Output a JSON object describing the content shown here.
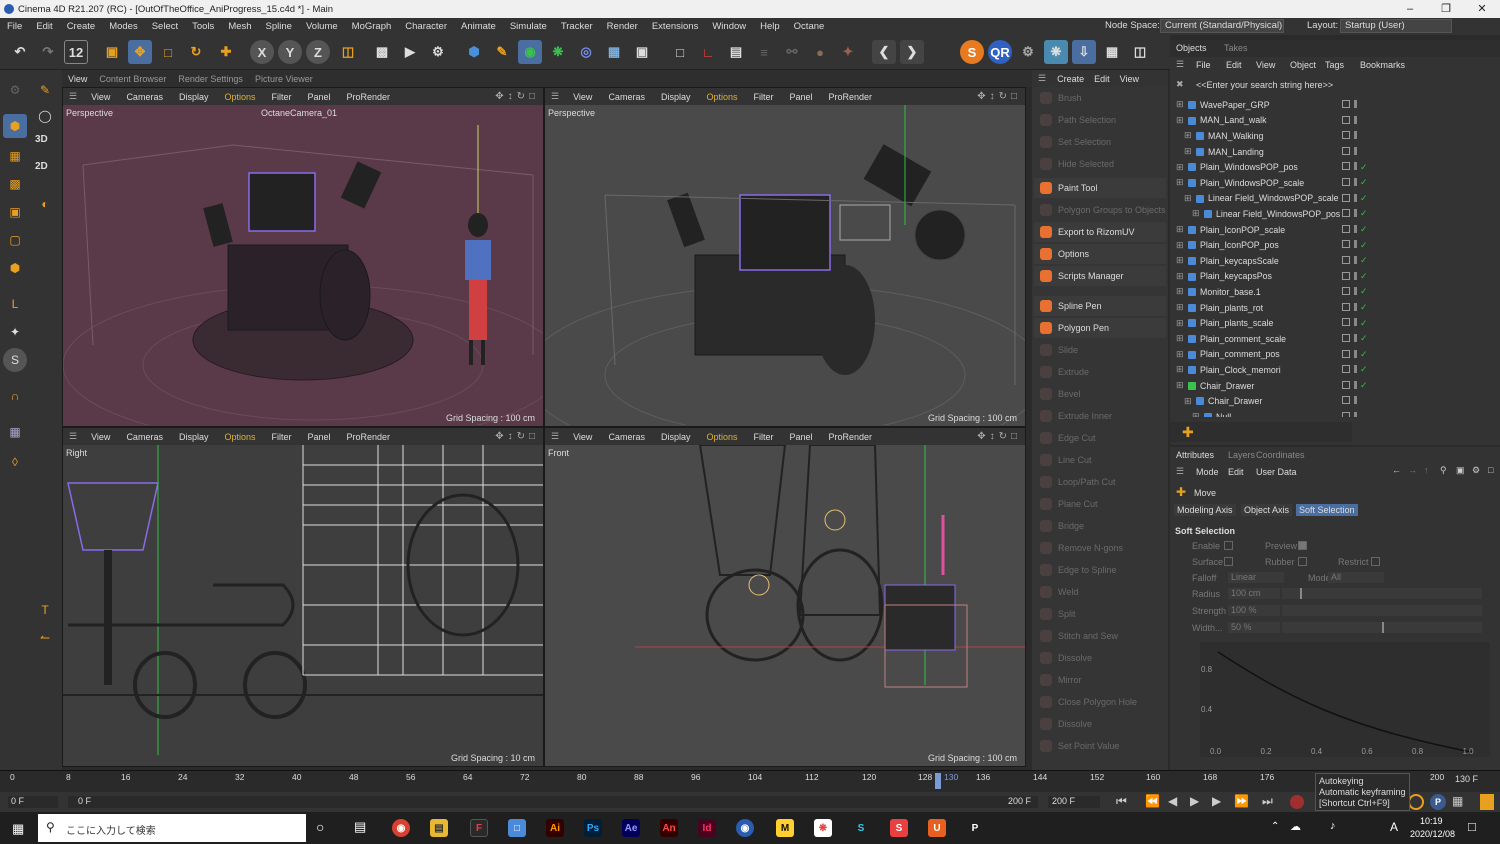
{
  "window": {
    "title": "Cinema 4D R21.207 (RC) - [OutOfTheOffice_AniProgress_15.c4d *] - Main"
  },
  "menu": [
    "File",
    "Edit",
    "Create",
    "Modes",
    "Select",
    "Tools",
    "Mesh",
    "Spline",
    "Volume",
    "MoGraph",
    "Character",
    "Animate",
    "Simulate",
    "Tracker",
    "Render",
    "Extensions",
    "Window",
    "Help",
    "Octane"
  ],
  "nodespace": {
    "label": "Node Space:",
    "value": "Current (Standard/Physical)"
  },
  "layout": {
    "label": "Layout:",
    "value": "Startup (User)"
  },
  "render_tabs": [
    "View",
    "Content Browser",
    "Render Settings",
    "Picture Viewer"
  ],
  "viewport_menu": [
    "View",
    "Cameras",
    "Display",
    "Options",
    "Filter",
    "Panel",
    "ProRender"
  ],
  "viewports": [
    {
      "label": "Perspective",
      "camera": "OctaneCamera_01",
      "grid": "Grid Spacing : 100 cm"
    },
    {
      "label": "Perspective",
      "camera": "",
      "grid": "Grid Spacing : 100 cm"
    },
    {
      "label": "Right",
      "camera": "",
      "grid": "Grid Spacing : 10 cm"
    },
    {
      "label": "Front",
      "camera": "",
      "grid": "Grid Spacing : 100 cm"
    }
  ],
  "left_tool_labels": {
    "threed": "3D",
    "twod": "2D"
  },
  "cmd_menu": [
    "Create",
    "Edit",
    "View"
  ],
  "commands": [
    {
      "label": "Brush",
      "on": false
    },
    {
      "label": "Path Selection",
      "on": false
    },
    {
      "label": "Set Selection",
      "on": false
    },
    {
      "label": "Hide Selected",
      "on": false
    },
    {
      "label": "Paint Tool",
      "on": true
    },
    {
      "label": "Polygon Groups to Objects",
      "on": false
    },
    {
      "label": "Export to RizomUV",
      "on": true
    },
    {
      "label": "Options",
      "on": true
    },
    {
      "label": "Scripts Manager",
      "on": true
    },
    {
      "label": "Spline Pen",
      "on": true
    },
    {
      "label": "Polygon Pen",
      "on": true
    },
    {
      "label": "Slide",
      "on": false
    },
    {
      "label": "Extrude",
      "on": false
    },
    {
      "label": "Bevel",
      "on": false
    },
    {
      "label": "Extrude Inner",
      "on": false
    },
    {
      "label": "Edge Cut",
      "on": false
    },
    {
      "label": "Line Cut",
      "on": false
    },
    {
      "label": "Loop/Path Cut",
      "on": false
    },
    {
      "label": "Plane Cut",
      "on": false
    },
    {
      "label": "Bridge",
      "on": false
    },
    {
      "label": "Remove N-gons",
      "on": false
    },
    {
      "label": "Edge to Spline",
      "on": false
    },
    {
      "label": "Weld",
      "on": false
    },
    {
      "label": "Split",
      "on": false
    },
    {
      "label": "Stitch and Sew",
      "on": false
    },
    {
      "label": "Dissolve",
      "on": false
    },
    {
      "label": "Mirror",
      "on": false
    },
    {
      "label": "Close Polygon Hole",
      "on": false
    },
    {
      "label": "Dissolve",
      "on": false
    },
    {
      "label": "Set Point Value",
      "on": false
    }
  ],
  "objects_tabs": [
    "Objects",
    "Takes"
  ],
  "objects_menu": [
    "File",
    "Edit",
    "View",
    "Object",
    "Tags",
    "Bookmarks"
  ],
  "search_placeholder": "<<Enter your search string here>>",
  "objects": [
    {
      "name": "WavePaper_GRP",
      "indent": 0,
      "check": false
    },
    {
      "name": "MAN_Land_walk",
      "indent": 0,
      "check": false
    },
    {
      "name": "MAN_Walking",
      "indent": 1,
      "check": false
    },
    {
      "name": "MAN_Landing",
      "indent": 1,
      "check": false
    },
    {
      "name": "Plain_WindowsPOP_pos",
      "indent": 0,
      "check": true
    },
    {
      "name": "Plain_WindowsPOP_scale",
      "indent": 0,
      "check": true
    },
    {
      "name": "Linear Field_WindowsPOP_scale",
      "indent": 1,
      "check": true
    },
    {
      "name": "Linear Field_WindowsPOP_pos",
      "indent": 2,
      "check": true
    },
    {
      "name": "Plain_IconPOP_scale",
      "indent": 0,
      "check": true
    },
    {
      "name": "Plain_IconPOP_pos",
      "indent": 0,
      "check": true
    },
    {
      "name": "Plain_keycapsScale",
      "indent": 0,
      "check": true
    },
    {
      "name": "Plain_keycapsPos",
      "indent": 0,
      "check": true
    },
    {
      "name": "Monitor_base.1",
      "indent": 0,
      "check": true
    },
    {
      "name": "Plain_plants_rot",
      "indent": 0,
      "check": true
    },
    {
      "name": "Plain_plants_scale",
      "indent": 0,
      "check": true
    },
    {
      "name": "Plain_comment_scale",
      "indent": 0,
      "check": true
    },
    {
      "name": "Plain_comment_pos",
      "indent": 0,
      "check": true
    },
    {
      "name": "Plain_Clock_memori",
      "indent": 0,
      "check": true
    },
    {
      "name": "Chair_Drawer",
      "indent": 0,
      "check": true
    },
    {
      "name": "Chair_Drawer",
      "indent": 1,
      "check": false
    },
    {
      "name": "Null",
      "indent": 2,
      "check": false
    }
  ],
  "attr_tabs": [
    "Attributes",
    "Layers",
    "Coordinates"
  ],
  "attr_menu": [
    "Mode",
    "Edit",
    "User Data"
  ],
  "attr_tool": "Move",
  "attr_subtabs": [
    "Modeling Axis",
    "Object Axis",
    "Soft Selection"
  ],
  "soft": {
    "title": "Soft Selection",
    "enable": "Enable",
    "preview": "Preview",
    "surface": "Surface",
    "rubber": "Rubber",
    "restrict": "Restrict",
    "falloff_label": "Falloff",
    "falloff": "Linear",
    "mode_label": "Mode",
    "mode": "All",
    "radius_label": "Radius",
    "radius": "100 cm",
    "strength_label": "Strength",
    "strength": "100 %",
    "width_label": "Width...",
    "width": "50 %"
  },
  "curve": {
    "yticks": [
      "0.8",
      "0.4"
    ],
    "xticks": [
      "0.0",
      "0.2",
      "0.4",
      "0.6",
      "0.8",
      "1.0"
    ]
  },
  "timeline": {
    "ticks": [
      "0",
      "8",
      "16",
      "24",
      "32",
      "40",
      "48",
      "56",
      "64",
      "72",
      "80",
      "88",
      "96",
      "104",
      "112",
      "120",
      "128",
      "130",
      "136",
      "144",
      "152",
      "160",
      "168",
      "176",
      "200"
    ],
    "end": "130 F"
  },
  "playbar": {
    "start": "0 F",
    "field": "0 F",
    "max": "200 F",
    "max2": "200 F"
  },
  "tooltip": {
    "title": "Autokeying",
    "line1": "Automatic keyframing",
    "line2": "[Shortcut Ctrl+F9]"
  },
  "taskbar": {
    "search": "ここに入力して検索",
    "time": "10:19",
    "date": "2020/12/08",
    "ime": "A"
  }
}
